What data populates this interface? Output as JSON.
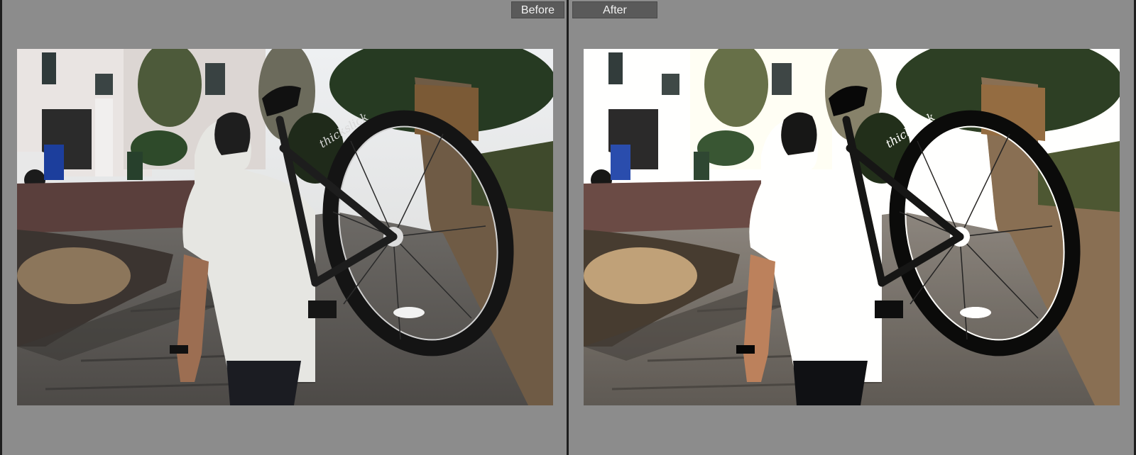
{
  "view": {
    "before_label": "Before",
    "after_label": "After"
  },
  "photo": {
    "wheel_text": "thickslick"
  },
  "colors": {
    "background": "#8c8c8c",
    "tab_bg": "#5a5a5a",
    "tab_text": "#f2f2f2",
    "border": "#1e1e1e"
  }
}
